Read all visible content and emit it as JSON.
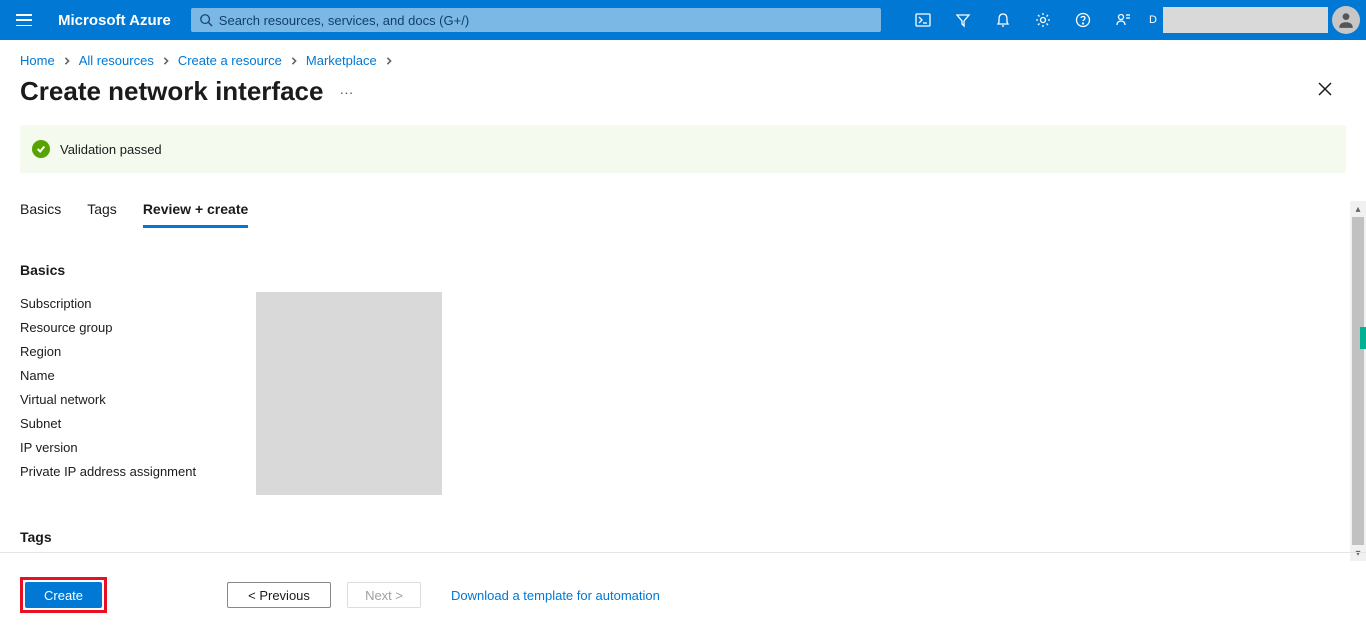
{
  "header": {
    "brand": "Microsoft Azure",
    "search_placeholder": "Search resources, services, and docs (G+/)",
    "directory_prefix": "D"
  },
  "breadcrumb": {
    "items": [
      "Home",
      "All resources",
      "Create a resource",
      "Marketplace"
    ]
  },
  "page": {
    "title": "Create network interface",
    "more": "···"
  },
  "validation": {
    "message": "Validation passed"
  },
  "tabs": {
    "items": [
      {
        "label": "Basics",
        "active": false
      },
      {
        "label": "Tags",
        "active": false
      },
      {
        "label": "Review + create",
        "active": true
      }
    ]
  },
  "summary": {
    "basics_heading": "Basics",
    "labels": [
      "Subscription",
      "Resource group",
      "Region",
      "Name",
      "Virtual network",
      "Subnet",
      "IP version",
      "Private IP address assignment"
    ],
    "tags_heading": "Tags"
  },
  "footer": {
    "create": "Create",
    "previous": "< Previous",
    "next": "Next >",
    "template_link": "Download a template for automation"
  }
}
